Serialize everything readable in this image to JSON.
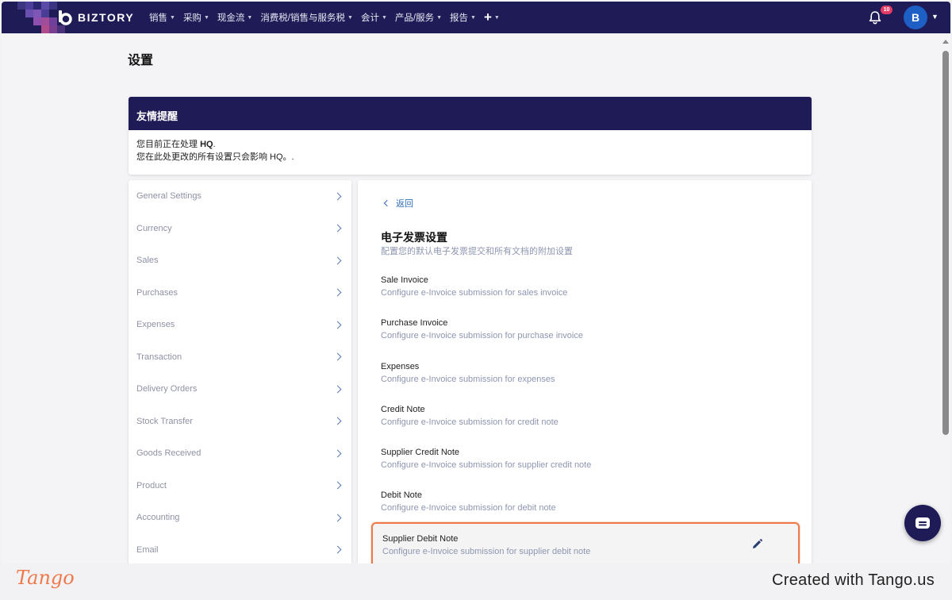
{
  "navbar": {
    "brand": "BIZTORY",
    "menu": [
      {
        "label": "销售"
      },
      {
        "label": "采购"
      },
      {
        "label": "现金流"
      },
      {
        "label": "消费税/销售与服务税"
      },
      {
        "label": "会计"
      },
      {
        "label": "产品/服务"
      },
      {
        "label": "报告"
      }
    ],
    "plus_label": "+",
    "notification_count": "10",
    "avatar_initial": "B"
  },
  "page": {
    "title": "设置"
  },
  "reminder": {
    "heading": "友情提醒",
    "line1_prefix": "您目前正在处理 ",
    "line1_entity": "HQ",
    "line1_suffix": ".",
    "line2": "您在此处更改的所有设置只会影响 HQ。."
  },
  "sidebar": {
    "items": [
      {
        "label": "General Settings"
      },
      {
        "label": "Currency"
      },
      {
        "label": "Sales"
      },
      {
        "label": "Purchases"
      },
      {
        "label": "Expenses"
      },
      {
        "label": "Transaction"
      },
      {
        "label": "Delivery Orders"
      },
      {
        "label": "Stock Transfer"
      },
      {
        "label": "Goods Received"
      },
      {
        "label": "Product"
      },
      {
        "label": "Accounting"
      },
      {
        "label": "Email"
      }
    ]
  },
  "panel": {
    "back_label": "返回",
    "section_title": "电子发票设置",
    "section_desc": "配置您的默认电子发票提交和所有文档的附加设置",
    "settings": [
      {
        "title": "Sale Invoice",
        "desc": "Configure e-Invoice submission for sales invoice"
      },
      {
        "title": "Purchase Invoice",
        "desc": "Configure e-Invoice submission for purchase invoice"
      },
      {
        "title": "Expenses",
        "desc": "Configure e-Invoice submission for expenses"
      },
      {
        "title": "Credit Note",
        "desc": "Configure e-Invoice submission for credit note"
      },
      {
        "title": "Supplier Credit Note",
        "desc": "Configure e-Invoice submission for supplier credit note"
      },
      {
        "title": "Debit Note",
        "desc": "Configure e-Invoice submission for debit note"
      },
      {
        "title": "Supplier Debit Note",
        "desc": "Configure e-Invoice submission for supplier debit note"
      }
    ]
  },
  "footer": {
    "logo": "Tango",
    "credit": "Created with Tango.us"
  },
  "colors": {
    "navbar": "#1f1b57",
    "accent_link": "#2f6fb8",
    "highlight_border": "#ee7a4c",
    "badge": "#e23b64"
  },
  "icons": {
    "bell": "bell-icon",
    "edit": "pencil-icon",
    "chat": "chat-icon",
    "chevron": "chevron-right-icon",
    "back": "chevron-left-icon"
  }
}
